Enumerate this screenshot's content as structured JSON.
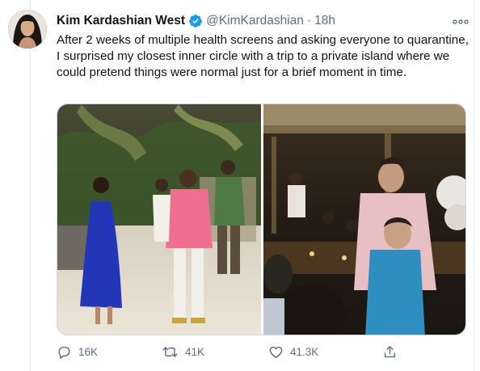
{
  "tweet": {
    "display_name": "Kim Kardashian West",
    "handle": "@KimKardashian",
    "separator": "·",
    "timestamp": "18h",
    "text": "After 2 weeks of multiple health screens and asking everyone to quarantine, I surprised my closest inner circle with a trip to a private island where we could pretend things were normal just for a brief moment in time.",
    "verified": true
  },
  "icons": {
    "verified": "verified-badge-icon",
    "more": "more-options-icon",
    "reply": "reply-icon",
    "retweet": "retweet-icon",
    "like": "heart-icon",
    "share": "share-icon"
  },
  "actions": {
    "replies": "16K",
    "retweets": "41K",
    "likes": "41.3K"
  },
  "colors": {
    "accent": "#1d9bf0",
    "secondary_text": "#5b7083",
    "border": "#e6ecf0"
  }
}
